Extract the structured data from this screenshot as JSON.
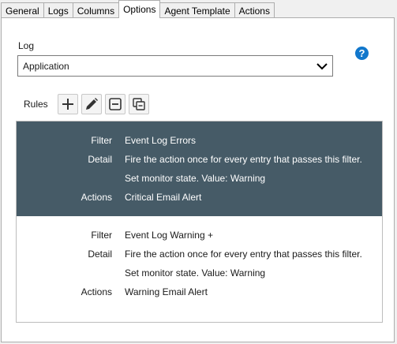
{
  "tabs": [
    "General",
    "Logs",
    "Columns",
    "Options",
    "Agent Template",
    "Actions"
  ],
  "active_tab": "Options",
  "log": {
    "label": "Log",
    "value": "Application"
  },
  "help": {
    "glyph": "?"
  },
  "rules": {
    "label": "Rules",
    "toolbar": [
      "plus-icon",
      "pencil-icon",
      "minus-box-icon",
      "copy-icon"
    ],
    "field_labels": {
      "filter": "Filter",
      "detail": "Detail",
      "actions": "Actions"
    },
    "items": [
      {
        "selected": true,
        "filter": "Event Log Errors",
        "detail1": "Fire the action once for every entry that passes this filter.",
        "detail2": "Set monitor state.  Value: Warning",
        "actions": "Critical Email Alert"
      },
      {
        "selected": false,
        "filter": "Event Log Warning +",
        "detail1": "Fire the action once for every entry that passes this filter.",
        "detail2": "Set monitor state.  Value: Warning",
        "actions": "Warning Email Alert"
      }
    ]
  },
  "colors": {
    "selected_row": "#465b67",
    "help": "#1177cc"
  }
}
